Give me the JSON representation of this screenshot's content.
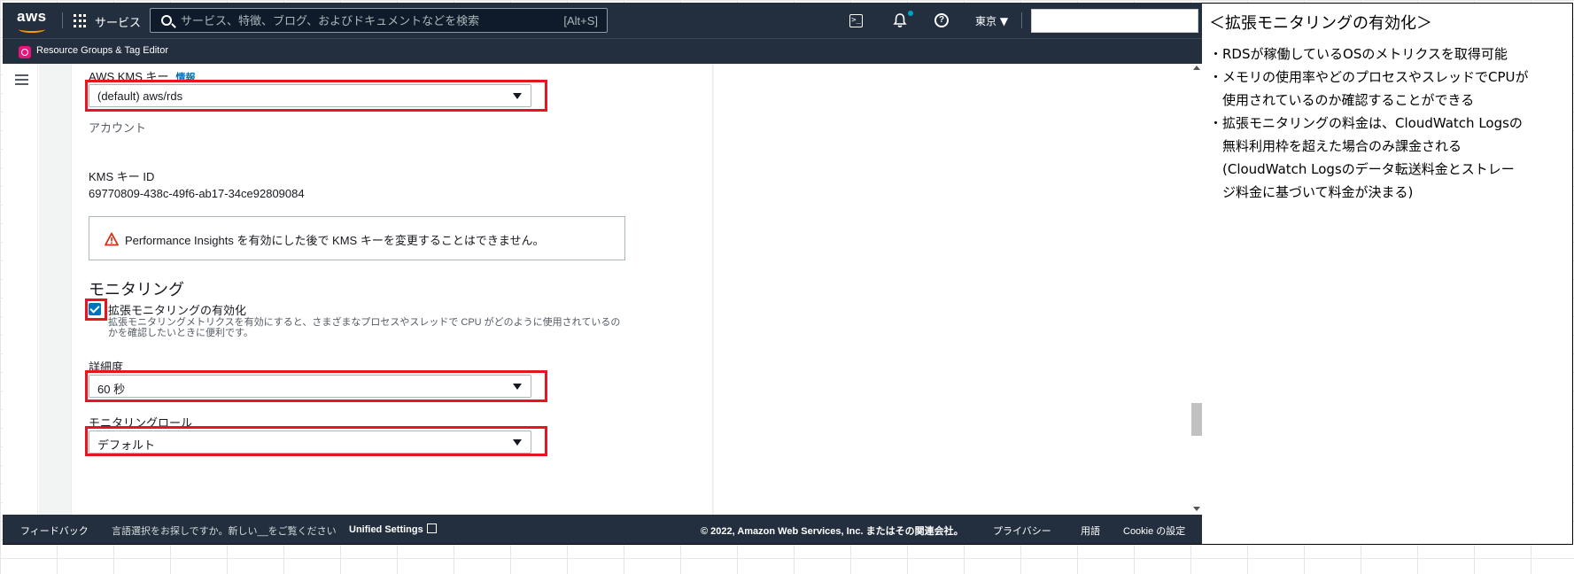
{
  "topnav": {
    "logo": "aws",
    "services_label": "サービス",
    "search_placeholder": "サービス、特徴、ブログ、およびドキュメントなどを検索",
    "search_shortcut": "[Alt+S]",
    "region": "東京 ▼"
  },
  "subnav": {
    "label": "Resource Groups & Tag Editor"
  },
  "form": {
    "kms_key_label": "AWS KMS キー",
    "kms_info_link": "情報",
    "kms_key_value": "(default) aws/rds",
    "account_label": "アカウント",
    "kms_id_label": "KMS キー ID",
    "kms_id_value": "69770809-438c-49f6-ab17-34ce92809084",
    "alert_text": "Performance Insights を有効にした後で KMS キーを変更することはできません。",
    "monitoring_title": "モニタリング",
    "enhanced_monitoring_label": "拡張モニタリングの有効化",
    "enhanced_monitoring_desc": "拡張モニタリングメトリクスを有効にすると、さまざまなプロセスやスレッドで CPU がどのように使用されているのかを確認したいときに便利です。",
    "granularity_label": "詳細度",
    "granularity_value": "60 秒",
    "monitoring_role_label": "モニタリングロール",
    "monitoring_role_value": "デフォルト"
  },
  "footer": {
    "feedback": "フィードバック",
    "language_prompt": "言語選択をお探しですか。新しい__をご覧ください",
    "unified_settings": "Unified Settings",
    "copyright": "© 2022, Amazon Web Services, Inc. またはその関連会社。",
    "privacy": "プライバシー",
    "terms": "用語",
    "cookie": "Cookie の設定"
  },
  "notes": {
    "title": "＜拡張モニタリングの有効化＞",
    "lines": [
      "・RDSが稼働しているOSのメトリクスを取得可能",
      "・メモリの使用率やどのプロセスやスレッドでCPUが",
      "　使用されているのか確認することができる",
      "・拡張モニタリングの料金は、CloudWatch Logsの",
      "　無料利用枠を超えた場合のみ課金される",
      "　(CloudWatch Logsのデータ転送料金とストレー",
      "　ジ料金に基づいて料金が決まる)"
    ]
  },
  "colors": {
    "nav_bg": "#232f3e",
    "highlight": "#e8141f",
    "link": "#0073bb",
    "accent": "#ff9900"
  }
}
